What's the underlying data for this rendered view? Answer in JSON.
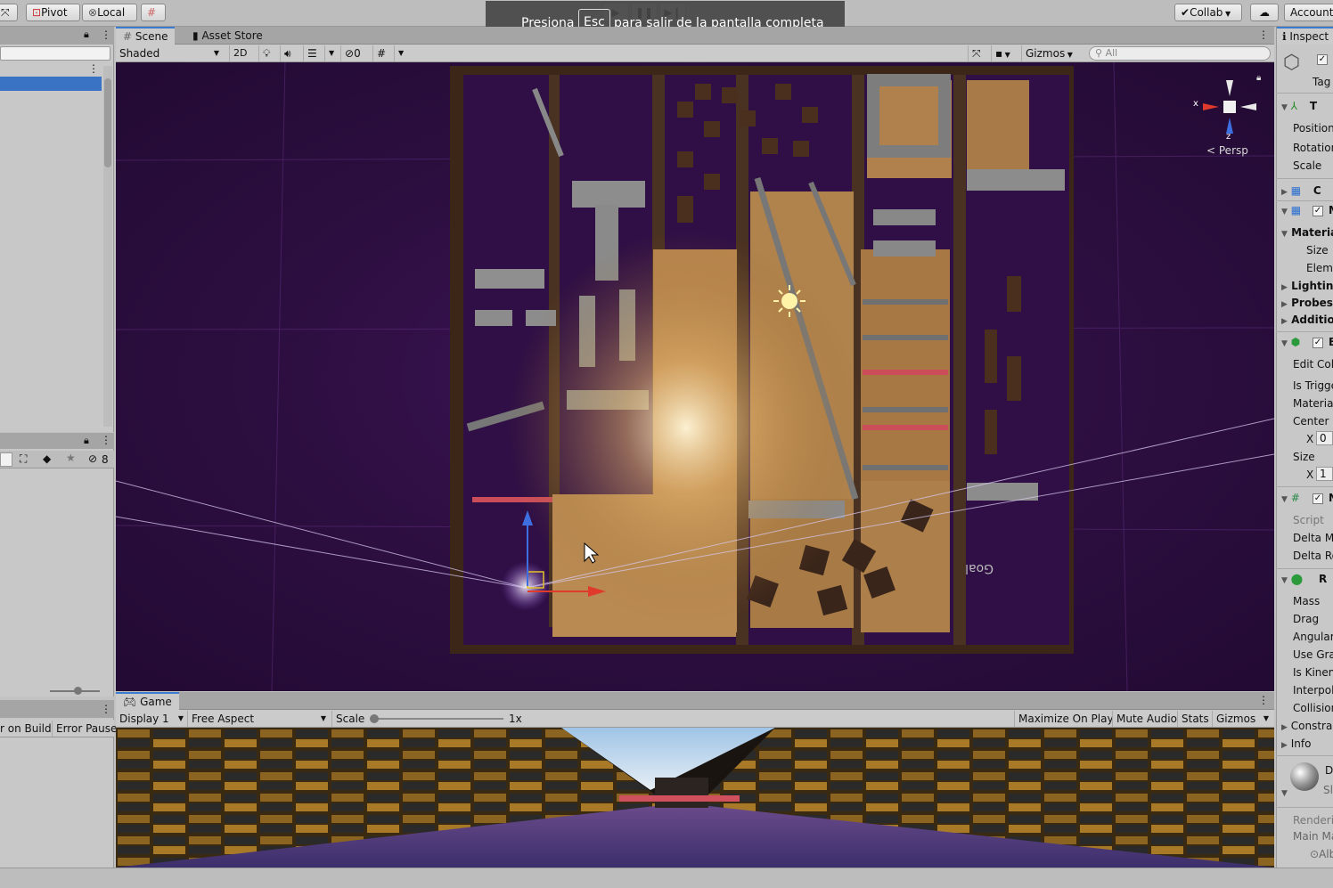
{
  "toolbar": {
    "pivot_label": "Pivot",
    "local_label": "Local",
    "collab_label": "Collab",
    "account_label": "Account"
  },
  "fullscreen_notice": {
    "prefix": "Presiona",
    "key": "Esc",
    "suffix": "para salir de la pantalla completa"
  },
  "scene": {
    "tab_scene": "Scene",
    "tab_asset_store": "Asset Store",
    "shading_mode": "Shaded",
    "mode_2d": "2D",
    "hidden_count": "0",
    "gizmos_label": "Gizmos",
    "search_placeholder": "All",
    "persp_label": "Persp",
    "axis_x": "x",
    "axis_z": "z"
  },
  "project": {
    "hidden_count": "8"
  },
  "console": {
    "error_on_build": "r on Build",
    "error_pause": "Error Pause"
  },
  "game": {
    "tab_label": "Game",
    "display": "Display 1",
    "aspect": "Free Aspect",
    "scale_label": "Scale",
    "scale_value": "1x",
    "scale_fraction": 0.0,
    "maximize_on_play": "Maximize On Play",
    "mute_audio": "Mute Audio",
    "stats": "Stats",
    "gizmos": "Gizmos"
  },
  "inspector": {
    "tab": "Inspect",
    "tag": "Tag",
    "position": "Position",
    "rotation": "Rotation",
    "scale": "Scale",
    "materials": "Materia",
    "size": "Size",
    "element": "Eleme",
    "lighting": "Lighting",
    "probes": "Probes",
    "additional": "Additio",
    "edit_collider": "Edit Coll",
    "is_trigger": "Is Trigge",
    "material": "Material",
    "center": "Center",
    "center_x_label": "X",
    "center_x": "0",
    "size2": "Size",
    "size_x_label": "X",
    "size_x": "1",
    "script": "Script",
    "delta_m": "Delta M",
    "delta_r": "Delta Ro",
    "mass": "Mass",
    "drag": "Drag",
    "angular": "Angular",
    "use_gravity": "Use Gra",
    "is_kinematic": "Is Kinem",
    "interpolate": "Interpola",
    "collision": "Collision",
    "constraints": "Constra",
    "info": "Info",
    "material_initial": "D",
    "shader_initial": "Sl",
    "rendering": "Renderi",
    "main_maps": "Main Ma",
    "albedo": "Alb",
    "t_initial": "T",
    "c_initial": "C",
    "m_initial": "M",
    "b_initial": "B",
    "n_initial": "N",
    "r_initial": "R"
  },
  "level": {
    "goal_text": "Goal"
  }
}
